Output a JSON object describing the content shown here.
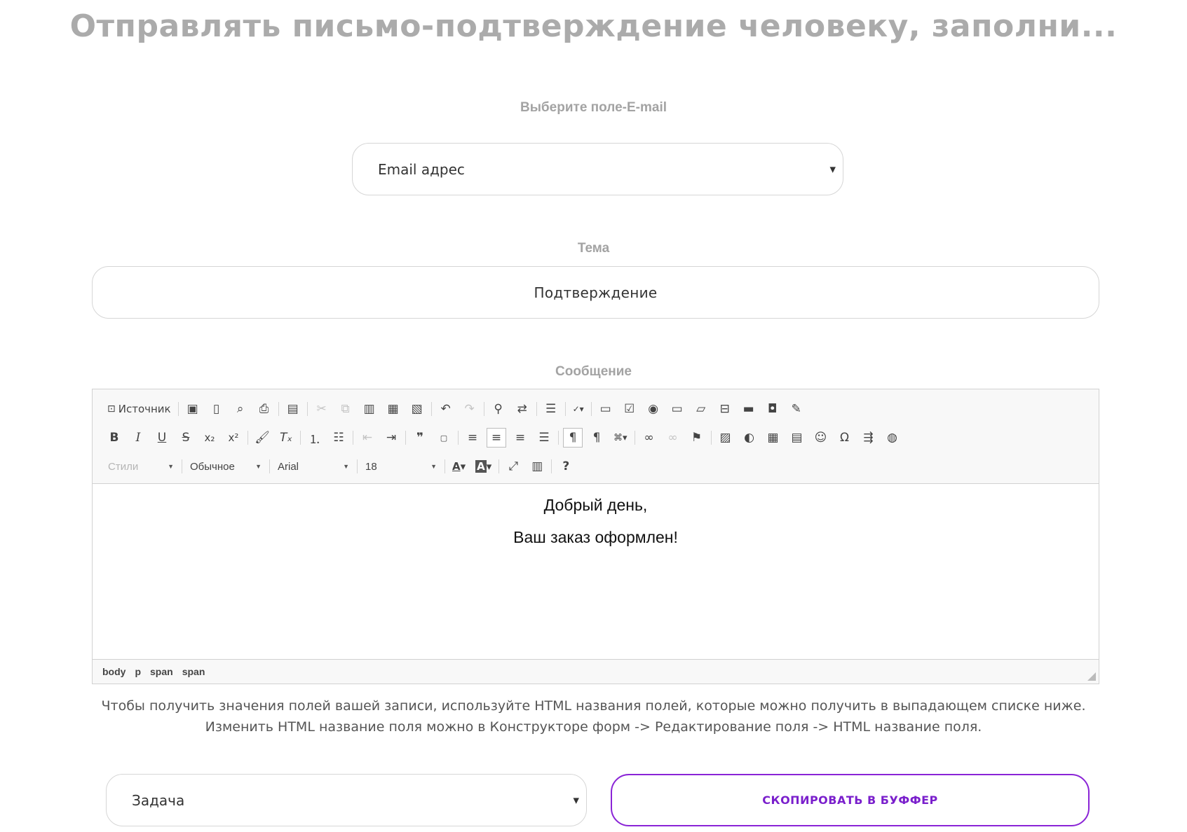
{
  "page": {
    "title": "Отправлять письмо-подтверждение человеку, заполни..."
  },
  "email_field": {
    "label": "Выберите поле-E-mail",
    "selected": "Email адрес"
  },
  "subject_field": {
    "label": "Тема",
    "value": "Подтверждение"
  },
  "message_field": {
    "label": "Сообщение"
  },
  "editor": {
    "source_label": "Источник",
    "styles_label": "Стили",
    "format_label": "Обычное",
    "font_label": "Arial",
    "size_label": "18",
    "content_lines": [
      "Добрый день,",
      "Ваш заказ оформлен!"
    ],
    "path": [
      "body",
      "p",
      "span",
      "span"
    ]
  },
  "hint": {
    "line1": "Чтобы получить значения полей вашей записи, используйте HTML названия полей, которые можно получить в выпадающем списке ниже.",
    "line2": "Изменить HTML название поля можно в Конструкторе форм -> Редактирование поля -> HTML название поля."
  },
  "field_select": {
    "selected": "Задача"
  },
  "copy_button": {
    "label": "СКОПИРОВАТЬ В БУФФЕР"
  },
  "colors": {
    "accent": "#7a1fcc",
    "label_gray": "#a3a3a3",
    "title_gray": "#ababab"
  }
}
